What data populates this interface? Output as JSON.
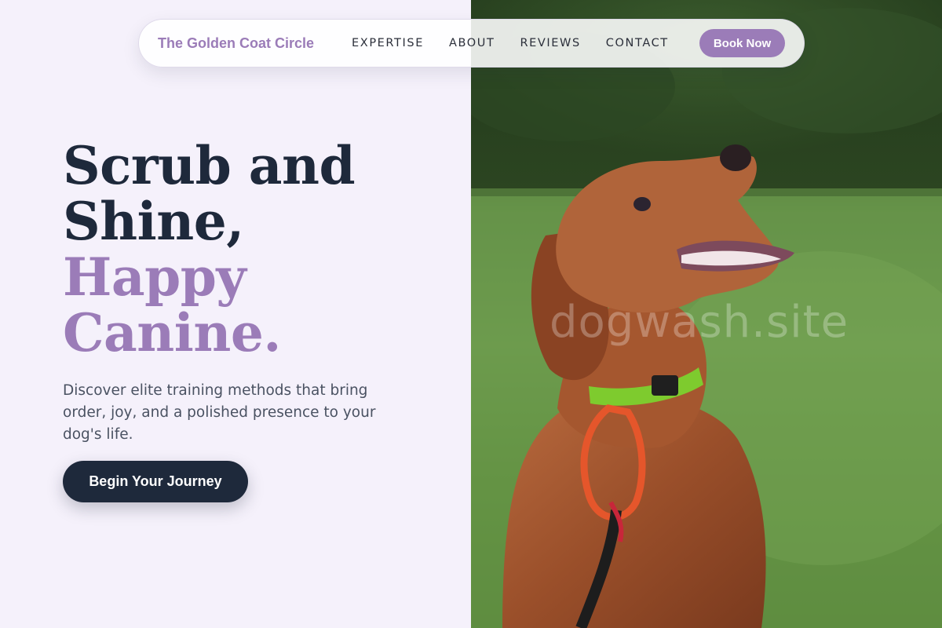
{
  "nav": {
    "brand": "The Golden Coat Circle",
    "links": [
      "EXPERTISE",
      "ABOUT",
      "REVIEWS",
      "CONTACT"
    ],
    "book_label": "Book Now"
  },
  "hero": {
    "title_line1": "Scrub and",
    "title_line2": "Shine,",
    "accent_line1": "Happy",
    "accent_line2": "Canine.",
    "subtitle": "Discover elite training methods that bring order, joy, and a polished presence to your dog's life.",
    "cta_label": "Begin Your Journey"
  },
  "photo": {
    "watermark": "dogwash.site",
    "subject": "dog-photo"
  },
  "colors": {
    "accent": "#9b7cb8",
    "dark": "#1e293b",
    "background": "#f5f1fb"
  }
}
